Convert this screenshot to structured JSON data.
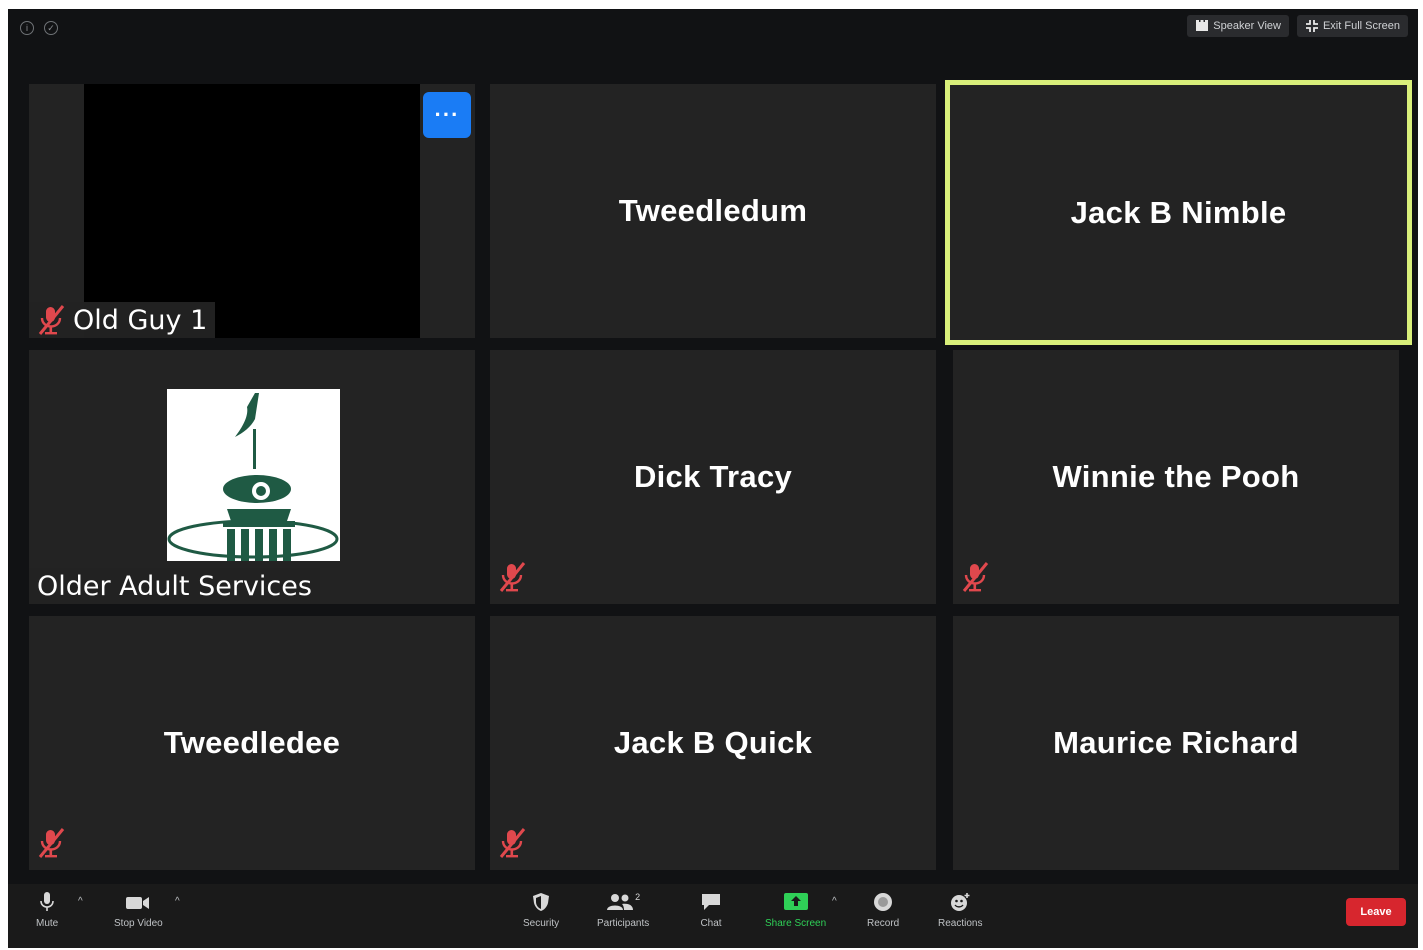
{
  "window": {
    "speaker_view_label": "Speaker View",
    "exit_full_screen_label": "Exit Full Screen"
  },
  "tiles": [
    {
      "name": "Old Guy 1"
    },
    {
      "name": "Tweedledum"
    },
    {
      "name": "Jack B Nimble"
    },
    {
      "name": "Older Adult Services"
    },
    {
      "name": "Dick Tracy"
    },
    {
      "name": "Winnie the Pooh"
    },
    {
      "name": "Tweedledee"
    },
    {
      "name": "Jack B Quick"
    },
    {
      "name": "Maurice Richard"
    }
  ],
  "more_button_label": "···",
  "toolbar": {
    "mute": "Mute",
    "stop_video": "Stop Video",
    "security": "Security",
    "participants": "Participants",
    "participants_count": "2",
    "chat": "Chat",
    "share_screen": "Share Screen",
    "record": "Record",
    "reactions": "Reactions",
    "leave": "Leave"
  },
  "colors": {
    "active_speaker_border": "#d9ef7a",
    "more_button": "#1a7cf5",
    "mute_icon": "#e0484d",
    "leave_button": "#d7262e",
    "share_screen": "#2fd057",
    "logo_green": "#1f5a44"
  }
}
